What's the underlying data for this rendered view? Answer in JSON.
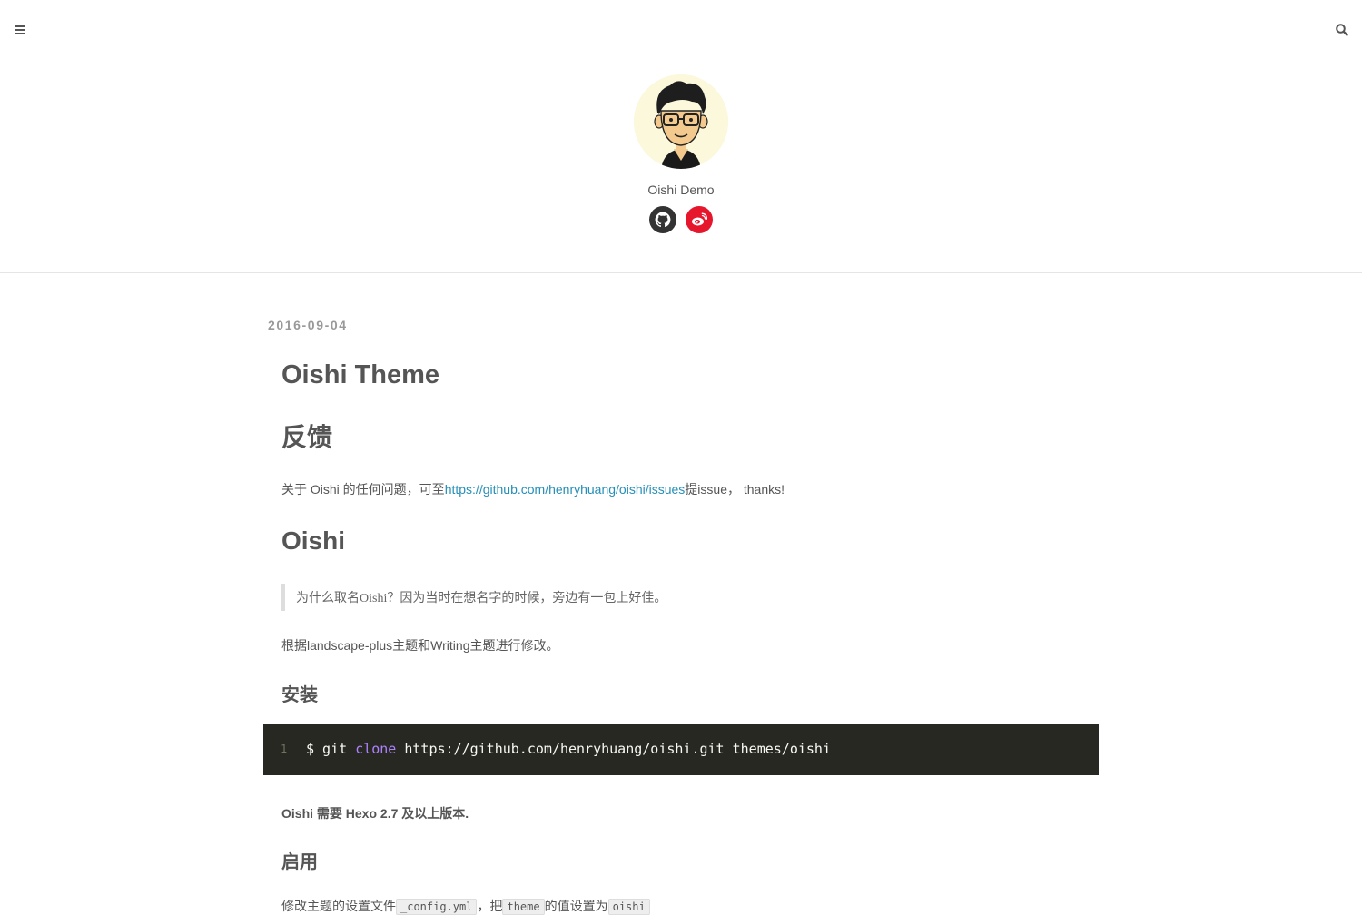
{
  "header": {
    "menu_icon": "bars-icon",
    "search_icon": "search-icon"
  },
  "profile": {
    "site_name": "Oishi Demo",
    "social": [
      {
        "icon": "github-icon",
        "color": "#333333"
      },
      {
        "icon": "weibo-icon",
        "color": "#e6162d"
      }
    ]
  },
  "post": {
    "date": "2016-09-04",
    "title": "Oishi Theme",
    "sections": {
      "feedback_heading": "反馈",
      "feedback_prefix": "关于 Oishi 的任何问题，可至",
      "feedback_link": "https://github.com/henryhuang/oishi/issues",
      "feedback_suffix": "提issue， thanks!",
      "oishi_heading": "Oishi",
      "quote": "为什么取名Oishi？因为当时在想名字的时候，旁边有一包上好佳。",
      "based_on": "根据landscape-plus主题和Writing主题进行修改。",
      "install_heading": "安装",
      "code": {
        "line_number": "1",
        "prompt": "$ git ",
        "keyword": "clone",
        "rest": " https://github.com/henryhuang/oishi.git themes/oishi"
      },
      "requirement": "Oishi 需要 Hexo 2.7 及以上版本.",
      "enable_heading": "启用",
      "config_text_1": "修改主题的设置文件",
      "config_code_1": "_config.yml",
      "config_text_2": "，把",
      "config_code_2": "theme",
      "config_text_3": "的值设置为",
      "config_code_3": "oishi"
    }
  },
  "colors": {
    "link": "#258fb8",
    "code_bg": "#272822",
    "code_keyword": "#ae81ff",
    "text": "#555555",
    "date": "#999999"
  }
}
